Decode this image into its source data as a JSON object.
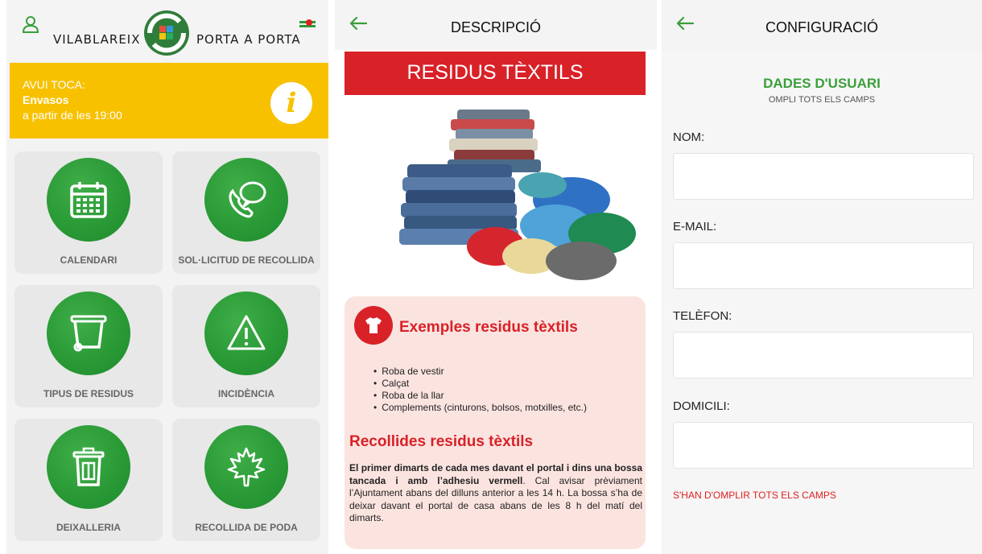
{
  "home": {
    "logo_left": "VILABLAREIX",
    "logo_right": "PORTA A PORTA",
    "banner": {
      "line1": "AVUI TOCA:",
      "line2": "Envasos",
      "line3": "a partir de les 19:00",
      "accent": "#f7c100"
    },
    "tiles": [
      {
        "label": "CALENDARI",
        "icon": "calendar-icon"
      },
      {
        "label": "SOL·LICITUD DE RECOLLIDA",
        "icon": "phone-chat-icon"
      },
      {
        "label": "TIPUS DE RESIDUS",
        "icon": "bin-icon"
      },
      {
        "label": "INCIDÈNCIA",
        "icon": "warning-icon"
      },
      {
        "label": "DEIXALLERIA",
        "icon": "trash-icon"
      },
      {
        "label": "RECOLLIDA DE PODA",
        "icon": "leaf-icon"
      }
    ],
    "tile_color": "#2a9a36"
  },
  "description": {
    "title": "DESCRIPCIÓ",
    "band": "RESIDUS TÈXTILS",
    "examples_title": "Exemples residus tèxtils",
    "examples": [
      "Roba de vestir",
      "Calçat",
      "Roba de la llar",
      "Complements (cinturons, bolsos, motxilles, etc.)"
    ],
    "collect_title": "Recollides residus tèxtils",
    "collect_bold": "El primer dimarts de cada mes davant el portal i dins una bossa tancada i amb l’adhesiu vermell",
    "collect_rest": ". Cal avisar prèviament l’Ajuntament abans del dilluns anterior a les 14 h. La bossa s’ha de deixar davant el portal de casa abans de les 8 h del matí del dimarts.",
    "accent": "#d92128"
  },
  "settings": {
    "title": "CONFIGURACIÓ",
    "heading": "DADES D'USUARI",
    "subheading": "OMPLI TOTS ELS CAMPS",
    "fields": [
      {
        "label": "NOM:",
        "value": ""
      },
      {
        "label": "E-MAIL:",
        "value": ""
      },
      {
        "label": "TELÈFON:",
        "value": ""
      },
      {
        "label": "DOMICILI:",
        "value": ""
      }
    ],
    "error": "S'HAN D'OMPLIR TOTS ELS CAMPS",
    "accent": "#3a9f3a"
  }
}
